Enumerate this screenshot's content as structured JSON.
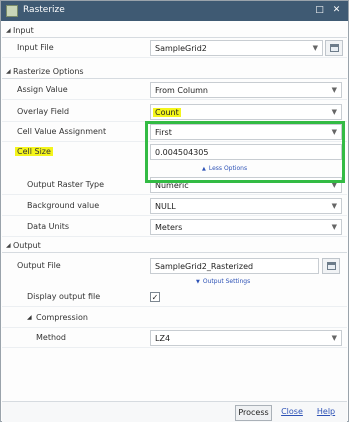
{
  "window": {
    "title": "Rasterize"
  },
  "sections": {
    "input": "Input",
    "rasterize_options": "Rasterize Options",
    "output": "Output"
  },
  "fields": {
    "input_file": {
      "label": "Input File",
      "value": "SampleGrid2"
    },
    "assign_value": {
      "label": "Assign Value",
      "value": "From Column"
    },
    "overlay_field": {
      "label": "Overlay Field",
      "value": "Count"
    },
    "cell_value_assignment": {
      "label": "Cell Value Assignment",
      "value": "First"
    },
    "cell_size": {
      "label": "Cell Size",
      "value": "0.004504305"
    },
    "output_raster_type": {
      "label": "Output Raster Type",
      "value": "Numeric"
    },
    "background_value": {
      "label": "Background value",
      "value": "NULL"
    },
    "data_units": {
      "label": "Data Units",
      "value": "Meters"
    },
    "output_file": {
      "label": "Output File",
      "value": "SampleGrid2_Rasterized"
    },
    "display_output_file": {
      "label": "Display output file",
      "checked": true
    },
    "compression": {
      "label": "Compression"
    },
    "method": {
      "label": "Method",
      "value": "LZ4"
    }
  },
  "links": {
    "less_options": "Less Options",
    "output_settings": "Output Settings"
  },
  "footer": {
    "process": "Process",
    "close": "Close",
    "help": "Help"
  },
  "colors": {
    "highlight": "#f4f51b",
    "green_box": "#33bb44",
    "titlebar": "#3f5a73",
    "link": "#2d52b6"
  }
}
